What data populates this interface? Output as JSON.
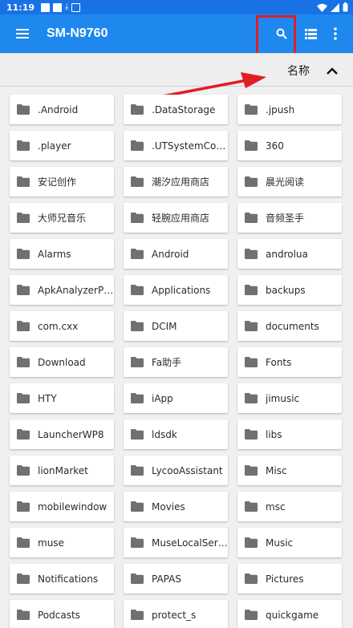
{
  "status_bar": {
    "time": "11:19"
  },
  "app_bar": {
    "title": "SM-N9760",
    "icons": [
      "menu-icon",
      "search-icon",
      "list-view-icon",
      "more-vert-icon"
    ]
  },
  "sort_bar": {
    "label": "名称",
    "direction_icon": "chevron-up-icon"
  },
  "folders": [
    ".Android",
    ".DataStorage",
    ".jpush",
    ".player",
    ".UTSystemCon...",
    "360",
    "安记创作",
    "潮汐应用商店",
    "晨光阅读",
    "大师兄音乐",
    "轻腕应用商店",
    "音频圣手",
    "Alarms",
    "Android",
    "androlua",
    "ApkAnalyzerPlus",
    "Applications",
    "backups",
    "com.cxx",
    "DCIM",
    "documents",
    "Download",
    "Fa助手",
    "Fonts",
    "HTY",
    "iApp",
    "jimusic",
    "LauncherWP8",
    "ldsdk",
    "libs",
    "lionMarket",
    "LycooAssistant",
    "Misc",
    "mobilewindow",
    "Movies",
    "msc",
    "muse",
    "MuseLocalServ...",
    "Music",
    "Notifications",
    "PAPAS",
    "Pictures",
    "Podcasts",
    "protect_s",
    "quickgame"
  ],
  "colors": {
    "app_bar": "#1e88ee",
    "status_bar": "#1872e6",
    "annotation": "#e11d25"
  }
}
